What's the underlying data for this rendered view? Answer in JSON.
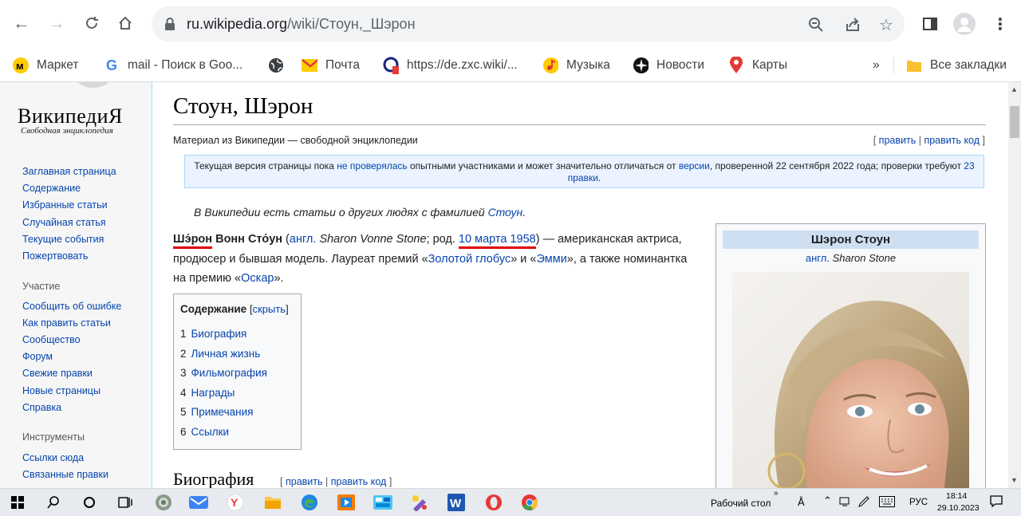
{
  "browser": {
    "url_host": "ru.wikipedia.org",
    "url_path": "/wiki/Стоун,_Шэрон",
    "bookmarks": [
      {
        "label": "Маркет",
        "icon": "market-icon"
      },
      {
        "label": "mail - Поиск в Goo...",
        "icon": "google-icon"
      },
      {
        "label": "",
        "icon": "globe-icon"
      },
      {
        "label": "Почта",
        "icon": "mail-icon"
      },
      {
        "label": "https://de.zxc.wiki/...",
        "icon": "zxc-icon"
      },
      {
        "label": "Музыка",
        "icon": "music-icon"
      },
      {
        "label": "Новости",
        "icon": "news-icon"
      },
      {
        "label": "Карты",
        "icon": "maps-icon"
      }
    ],
    "more": "»",
    "all_bookmarks": "Все закладки"
  },
  "sidebar": {
    "logo_title": "ВикипедиЯ",
    "logo_subtitle": "Свободная энциклопедия",
    "nav": [
      "Заглавная страница",
      "Содержание",
      "Избранные статьи",
      "Случайная статья",
      "Текущие события",
      "Пожертвовать"
    ],
    "participation_heading": "Участие",
    "participation": [
      "Сообщить об ошибке",
      "Как править статьи",
      "Сообщество",
      "Форум",
      "Свежие правки",
      "Новые страницы",
      "Справка"
    ],
    "tools_heading": "Инструменты",
    "tools": [
      "Ссылки сюда",
      "Связанные правки"
    ]
  },
  "article": {
    "title": "Стоун, Шэрон",
    "site_sub": "Материал из Википедии — свободной энциклопедии",
    "edit_open": "[",
    "edit": "править",
    "edit_sep": "|",
    "edit_code": "править код",
    "edit_close": "]",
    "notice_part1": "Текущая версия страницы пока ",
    "notice_link1": "не проверялась",
    "notice_part2": " опытными участниками и может значительно отличаться от ",
    "notice_link2": "версии",
    "notice_part3": ", проверенной 22 сентября 2022 года; проверки требуют ",
    "notice_link3": "23 правки",
    "notice_part4": ".",
    "hatnote_text": "В Википедии есть статьи о других людях с фамилией ",
    "hatnote_link": "Стоун",
    "hatnote_end": ".",
    "lead_name_a": "Шэ́рон",
    "lead_name_b": " Вонн Сто́ун",
    "lead_1": " (",
    "lead_engl": "англ.",
    "lead_en_name": " Sharon Vonne Stone",
    "lead_2": "; род. ",
    "lead_date": "10 марта",
    "lead_3": " ",
    "lead_year": "1958",
    "lead_4": ") — американская актриса, продюсер и бывшая модель. Лауреат премий «",
    "lead_gg": "Золотой глобус",
    "lead_5": "» и «",
    "lead_emmy": "Эмми",
    "lead_6": "», а также номинантка на премию «",
    "lead_oscar": "Оскар",
    "lead_7": "».",
    "toc_title": "Содержание",
    "toc_hide_open": "[",
    "toc_hide": "скрыть",
    "toc_hide_close": "]",
    "toc": [
      {
        "num": "1",
        "label": "Биография"
      },
      {
        "num": "2",
        "label": "Личная жизнь"
      },
      {
        "num": "3",
        "label": "Фильмография"
      },
      {
        "num": "4",
        "label": "Награды"
      },
      {
        "num": "5",
        "label": "Примечания"
      },
      {
        "num": "6",
        "label": "Ссылки"
      }
    ],
    "section_title": "Биография",
    "section_edit_open": "[",
    "section_edit": "править",
    "section_edit_sep": "|",
    "section_edit_code": "править код",
    "section_edit_close": "]"
  },
  "infobox": {
    "title": "Шэрон Стоун",
    "engl": "англ.",
    "en_name": "Sharon Stone"
  },
  "taskbar": {
    "desktop_label": "Рабочий стол",
    "chevron": "»",
    "lang": "РУС",
    "time": "18:14",
    "date": "29.10.2023"
  }
}
